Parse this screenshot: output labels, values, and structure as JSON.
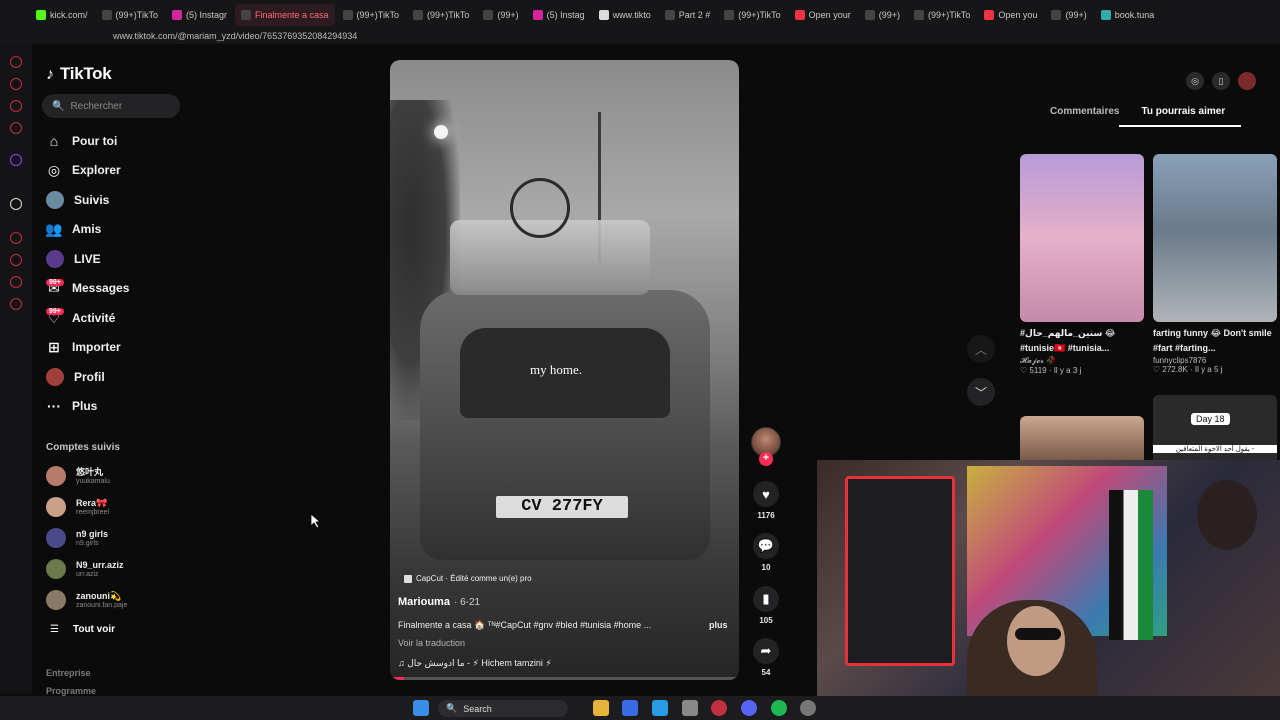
{
  "browser": {
    "tabs": [
      {
        "label": "kick.com/",
        "active": false
      },
      {
        "label": "(99+)TikTo",
        "active": false
      },
      {
        "label": "(5) Instagr",
        "active": false
      },
      {
        "label": "Finalmente a casa",
        "active": true
      },
      {
        "label": "(99+)TikTo",
        "active": false
      },
      {
        "label": "(99+)TikTo",
        "active": false
      },
      {
        "label": "(99+)",
        "active": false
      },
      {
        "label": "(5) Instag",
        "active": false
      },
      {
        "label": "www.tikto",
        "active": false
      },
      {
        "label": "Part 2 #",
        "active": false
      },
      {
        "label": "(99+)TikTo",
        "active": false
      },
      {
        "label": "Open your",
        "active": false
      },
      {
        "label": "(99+)",
        "active": false
      },
      {
        "label": "(99+)TikTo",
        "active": false
      },
      {
        "label": "Open you",
        "active": false
      },
      {
        "label": "(99+)",
        "active": false
      },
      {
        "label": "book.tuna",
        "active": false
      }
    ],
    "url": "www.tiktok.com/@mariam_yzd/video/7653769352084294934"
  },
  "sidebar": {
    "logo": "TikTok",
    "search_placeholder": "Rechercher",
    "nav": [
      {
        "label": "Pour toi",
        "icon": "home-icon"
      },
      {
        "label": "Explorer",
        "icon": "compass-icon"
      },
      {
        "label": "Suivis",
        "icon": "following-avatar-icon"
      },
      {
        "label": "Amis",
        "icon": "friends-icon"
      },
      {
        "label": "LIVE",
        "icon": "live-avatar-icon"
      },
      {
        "label": "Messages",
        "icon": "messages-icon",
        "badge": "99+"
      },
      {
        "label": "Activité",
        "icon": "activity-icon",
        "badge": "99+"
      },
      {
        "label": "Importer",
        "icon": "upload-icon"
      },
      {
        "label": "Profil",
        "icon": "profile-avatar-icon"
      },
      {
        "label": "Plus",
        "icon": "more-icon"
      }
    ],
    "followed_title": "Comptes suivis",
    "followed": [
      {
        "name": "悠叶丸",
        "handle": "yuukamalu"
      },
      {
        "name": "Rera🎀",
        "handle": "reemjbreel"
      },
      {
        "name": "n9 girls",
        "handle": "n9.girls"
      },
      {
        "name": "N9_urr.aziz",
        "handle": "urr.aziz"
      },
      {
        "name": "zanouni💫",
        "handle": "zanouni.fan.paje"
      }
    ],
    "see_all": "Tout voir",
    "footer": [
      "Entreprise",
      "Programme"
    ]
  },
  "video": {
    "overlay_text": "my home.",
    "plate": "CV 277FY",
    "capcut": "CapCut · Édité comme un(e) pro",
    "author": "Mariouma",
    "date": "· 6-21",
    "caption": "Finalmente a casa 🏠 ᵀᴺ#CapCut #gnv #bled #tunisia #home ...",
    "more": "plus",
    "translate": "Voir la traduction",
    "music": "♫ ما ادوسش حال - ⚡ Hichem tamzini ⚡",
    "progress": 0.04
  },
  "actions": {
    "likes": "1176",
    "comments": "10",
    "saves": "105",
    "shares": "54"
  },
  "right_panel": {
    "tabs": [
      "Commentaires",
      "Tu pourrais aimer"
    ],
    "cards": [
      {
        "title": "#سنين_مالهم_حال 😂 #tunisie🇹🇳 #tunisia...",
        "user": "𝓗𝓪𝓳𝓮𝓻 🥀",
        "meta": "♡ 5119 · Il y a 3 j"
      },
      {
        "title": "farting funny 😂 Don't smile #fart #farting...",
        "user": "funnyclips7876",
        "meta": "♡ 272.8K · Il y a 5 j"
      }
    ],
    "card3_label": "Day 18",
    "card3_sub": "يقول أحد الاخوة المتعافين -"
  },
  "taskbar": {
    "search": "Search"
  },
  "colors": {
    "accent": "#fe2c55",
    "bg": "#0b0b0c"
  }
}
